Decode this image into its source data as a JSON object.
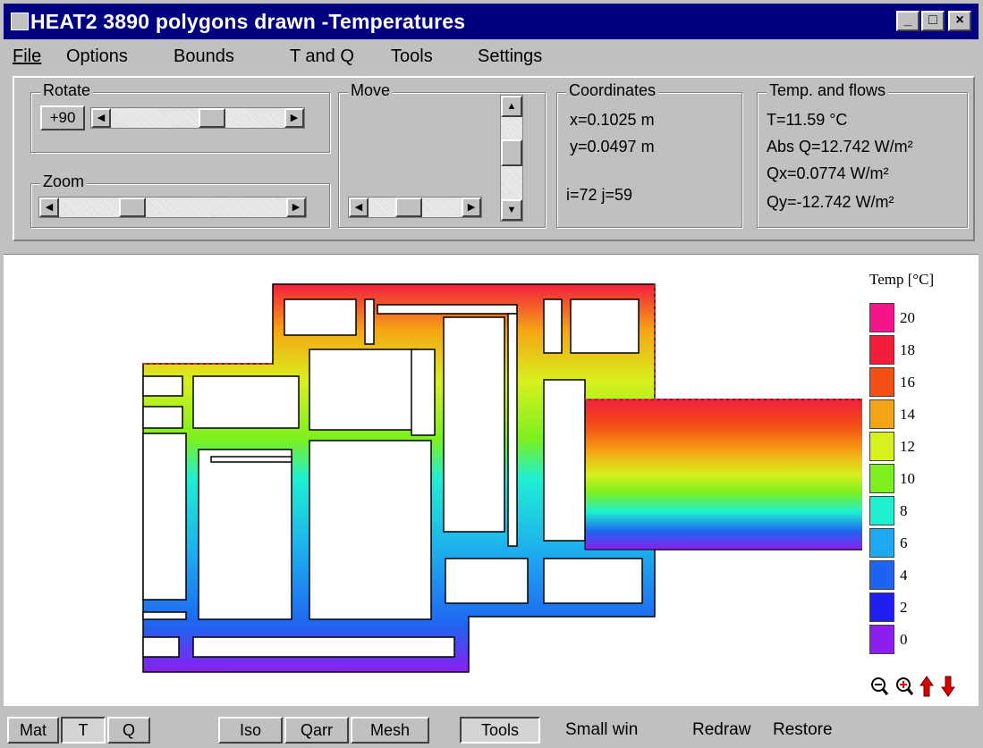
{
  "window": {
    "title": "HEAT2 3890 polygons drawn -Temperatures",
    "controls": {
      "minimize": "_",
      "maximize": "□",
      "close": "×"
    }
  },
  "menu": [
    "File",
    "Options",
    "Bounds",
    "T and Q",
    "Tools",
    "Settings"
  ],
  "rotate": {
    "label": "Rotate",
    "button": "+90",
    "slider_value": 0.6
  },
  "zoom": {
    "label": "Zoom",
    "slider_value": 0.3
  },
  "move": {
    "label": "Move",
    "h_value": 0.4,
    "v_value": 0.4
  },
  "coordinates": {
    "label": "Coordinates",
    "x": "x=0.1025 m",
    "y": "y=0.0497 m",
    "ij": "i=72 j=59"
  },
  "temps": {
    "label": "Temp. and flows",
    "t": "T=11.59 °C",
    "absq": "Abs Q=12.742 W/m²",
    "qx": "Qx=0.0774 W/m²",
    "qy": "Qy=-12.742 W/m²"
  },
  "legend": {
    "title": "Temp [°C]",
    "entries": [
      {
        "value": "20",
        "color": "#f5148a"
      },
      {
        "value": "18",
        "color": "#f21e3c"
      },
      {
        "value": "16",
        "color": "#f55014"
      },
      {
        "value": "14",
        "color": "#f5a514"
      },
      {
        "value": "12",
        "color": "#d8f01e"
      },
      {
        "value": "10",
        "color": "#7cf01e"
      },
      {
        "value": "8",
        "color": "#1ef0d2"
      },
      {
        "value": "6",
        "color": "#1eaaf0"
      },
      {
        "value": "4",
        "color": "#1e64f0"
      },
      {
        "value": "2",
        "color": "#1e1ef0"
      },
      {
        "value": "0",
        "color": "#8c1ef0"
      }
    ]
  },
  "canvas_icons": [
    "zoom-out-icon",
    "zoom-in-icon",
    "arrow-up-icon",
    "arrow-down-icon"
  ],
  "bottom": {
    "mat": "Mat",
    "t": "T",
    "q": "Q",
    "iso": "Iso",
    "qarr": "Qarr",
    "mesh": "Mesh",
    "tools": "Tools",
    "smallwin": "Small win",
    "redraw": "Redraw",
    "restore": "Restore"
  }
}
